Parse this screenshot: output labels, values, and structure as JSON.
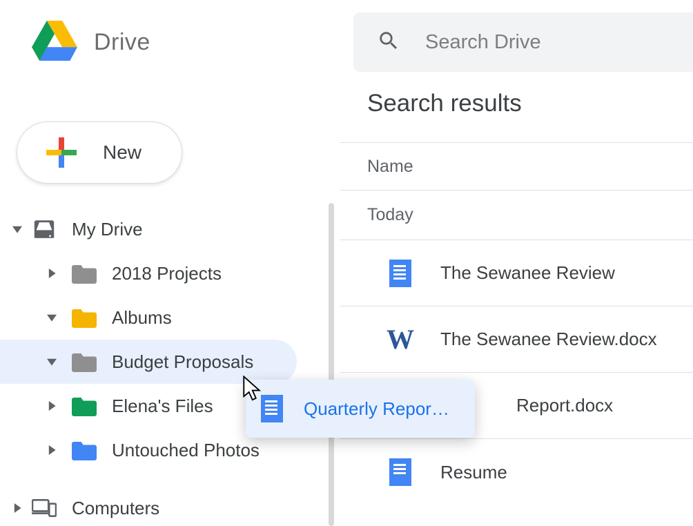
{
  "header": {
    "app_title": "Drive",
    "search_placeholder": "Search Drive",
    "new_button_label": "New"
  },
  "sidebar": {
    "root_label": "My Drive",
    "computers_label": "Computers",
    "items": [
      {
        "label": "2018 Projects",
        "expanded": false,
        "color": "gray"
      },
      {
        "label": "Albums",
        "expanded": true,
        "color": "yellow"
      },
      {
        "label": "Budget Proposals",
        "expanded": true,
        "color": "gray",
        "selected": true
      },
      {
        "label": "Elena's Files",
        "expanded": false,
        "color": "green"
      },
      {
        "label": "Untouched Photos",
        "expanded": false,
        "color": "blue"
      }
    ]
  },
  "results": {
    "title": "Search results",
    "column_header": "Name",
    "section": "Today",
    "files": [
      {
        "name": "The Sewanee Review",
        "icon": "docs"
      },
      {
        "name": "The Sewanee Review.docx",
        "icon": "word"
      },
      {
        "name": "Report.docx",
        "icon": "word"
      },
      {
        "name": "Resume",
        "icon": "docs"
      }
    ]
  },
  "drag": {
    "label": "Quarterly Repor…"
  },
  "colors": {
    "folder_gray": "#8f8f8f",
    "folder_yellow": "#f4b400",
    "folder_green": "#0f9d58",
    "folder_blue": "#4285f4",
    "accent": "#1a73e8"
  }
}
